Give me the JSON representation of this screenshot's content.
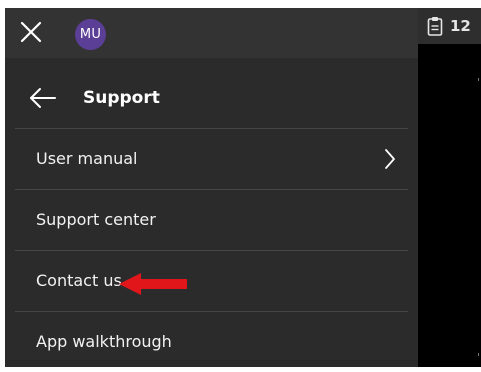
{
  "topbar": {
    "avatar_initials": "MU",
    "avatar_color": "#5b3f97"
  },
  "status": {
    "clip_count": "12"
  },
  "support_menu": {
    "title": "Support",
    "items": [
      {
        "label": "User manual",
        "has_submenu": true
      },
      {
        "label": "Support center",
        "has_submenu": false
      },
      {
        "label": "Contact us",
        "has_submenu": false
      },
      {
        "label": "App walkthrough",
        "has_submenu": false
      }
    ]
  },
  "annotation": {
    "arrow_color": "#e0161b",
    "points_to": "Contact us"
  },
  "icons": [
    "close-icon",
    "back-arrow-icon",
    "chevron-right-icon",
    "clipboard-icon"
  ]
}
